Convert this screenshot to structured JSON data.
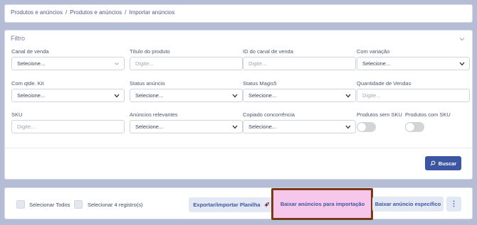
{
  "breadcrumb": [
    "Produtos e anúncios",
    "/",
    "Produtos e anúncios",
    "/",
    "Importar anúncios"
  ],
  "filter": {
    "title": "Filtro",
    "fields": {
      "canal_venda": {
        "label": "Canal de venda",
        "value": "Selecione..."
      },
      "titulo_produto": {
        "label": "Título do produto",
        "placeholder": "Digite..."
      },
      "id_canal_venda": {
        "label": "ID do canal de venda",
        "placeholder": "Digite..."
      },
      "com_variacao": {
        "label": "Com variação",
        "value": "Selecione..."
      },
      "com_qtde_kit": {
        "label": "Com qtde. Kit",
        "value": "Selecione..."
      },
      "status_anuncio": {
        "label": "Status anúncio",
        "value": "Selecione..."
      },
      "status_magis5": {
        "label": "Status Magis5",
        "value": "Selecione..."
      },
      "quantidade_vendas": {
        "label": "Quantidade de Vendas",
        "placeholder": "Digite..."
      },
      "sku": {
        "label": "SKU",
        "placeholder": "Digite..."
      },
      "anuncios_relevantes": {
        "label": "Anúncios relevantes",
        "value": "Selecione..."
      },
      "copiado_concorrencia": {
        "label": "Copiado concorrência",
        "value": "Selecione..."
      },
      "produtos_sem_sku": {
        "label": "Produtos sem SKU",
        "checked": false
      },
      "produtos_com_sku": {
        "label": "Produtos com SKU",
        "checked": false
      }
    },
    "search_label": "Buscar"
  },
  "actions": {
    "select_all": "Selecionar Todos",
    "select_records": "Selecionar 4 registro(s)",
    "export_import": "Exportar/importar Planilha",
    "download_for_import": "Baixar anúncios para importação",
    "download_specific": "Baixar anúncio específico",
    "more": "⋮"
  },
  "colors": {
    "primary": "#3d56a2",
    "highlight_border": "#7a3a16",
    "highlight_fill": "#f6c7ea",
    "background": "#b5bdd6"
  }
}
